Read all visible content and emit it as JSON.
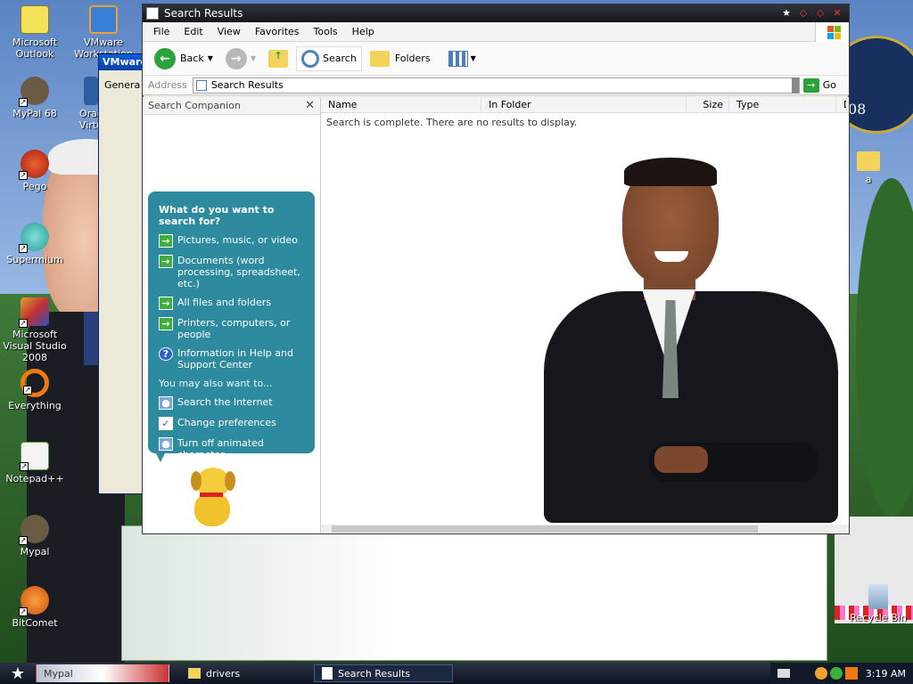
{
  "desktop": {
    "icons": [
      {
        "label": "Microsoft Outlook",
        "icon": "outlook-icon"
      },
      {
        "label": "VMware Workstation",
        "icon": "vmware-icon"
      },
      {
        "label": "MyPal 68",
        "icon": "mypal-icon"
      },
      {
        "label": "Orac Virtu",
        "icon": "virtualbox-icon"
      },
      {
        "label": "Pego",
        "icon": "pego-icon"
      },
      {
        "label": "Supermium",
        "icon": "supermium-icon"
      },
      {
        "label": "Microsoft Visual Studio 2008",
        "icon": "visual-studio-icon"
      },
      {
        "label": "Everything",
        "icon": "everything-icon"
      },
      {
        "label": "Notepad++",
        "icon": "notepadpp-icon"
      },
      {
        "label": "Mypal",
        "icon": "mypal-icon"
      },
      {
        "label": "BitComet",
        "icon": "bitcomet-icon"
      },
      {
        "label": "a",
        "icon": "folder-icon"
      },
      {
        "label": "Recycle Bin",
        "icon": "recycle-bin-icon"
      }
    ]
  },
  "bg_window": {
    "title": "VMware W",
    "tab": "Genera"
  },
  "window": {
    "title": "Search Results",
    "menu": [
      "File",
      "Edit",
      "View",
      "Favorites",
      "Tools",
      "Help"
    ],
    "toolbar": {
      "back": "Back",
      "search": "Search",
      "folders": "Folders"
    },
    "address": {
      "label": "Address",
      "value": "Search Results",
      "go": "Go"
    }
  },
  "companion": {
    "header": "Search Companion",
    "question": "What do you want to search for?",
    "options": [
      "Pictures, music, or video",
      "Documents (word processing, spreadsheet, etc.)",
      "All files and folders",
      "Printers, computers, or people",
      "Information in Help and Support Center"
    ],
    "also_label": "You may also want to...",
    "also": [
      "Search the Internet",
      "Change preferences",
      "Turn off animated character"
    ]
  },
  "results": {
    "columns": [
      "Name",
      "In Folder",
      "Size",
      "Type",
      "D"
    ],
    "message": "Search is complete. There are no results to display."
  },
  "taskbar": {
    "items": [
      "Mypal",
      "drivers",
      "Search Results"
    ],
    "clock": "3:19 AM"
  },
  "colors": {
    "accent": "#2e8a9e",
    "title_dark": "#15171b",
    "go_green": "#2aa33a"
  }
}
